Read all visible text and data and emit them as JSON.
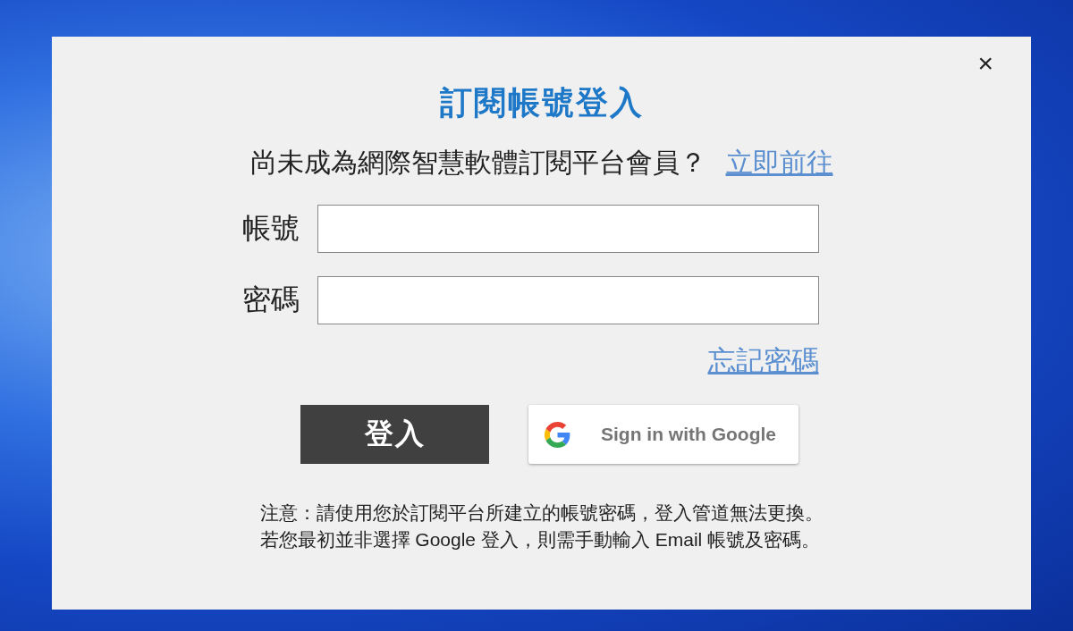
{
  "dialog": {
    "close": "×",
    "title": "訂閱帳號登入",
    "prompt": {
      "text": "尚未成為網際智慧軟體訂閱平台會員？",
      "link": "立即前往"
    },
    "fields": [
      {
        "label": "帳號"
      },
      {
        "label": "密碼"
      }
    ],
    "forgot_link": "忘記密碼",
    "buttons": {
      "login": "登入",
      "google": "Sign in with Google"
    },
    "notes": [
      "注意：請使用您於訂閱平台所建立的帳號密碼，登入管道無法更換。",
      "若您最初並非選擇 Google 登入，則需手動輸入 Email 帳號及密碼。"
    ]
  }
}
